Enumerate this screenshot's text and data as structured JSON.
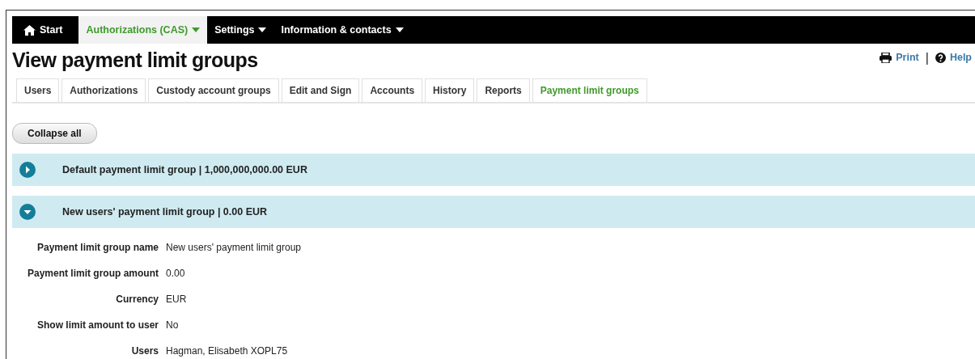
{
  "nav": [
    {
      "label": "Start",
      "kind": "home",
      "selected": false
    },
    {
      "label": "Authorizations (CAS)",
      "kind": "menu",
      "selected": true
    },
    {
      "label": "Settings",
      "kind": "menu",
      "selected": false
    },
    {
      "label": "Information & contacts",
      "kind": "menu",
      "selected": false
    }
  ],
  "title": "View payment limit groups",
  "links": [
    {
      "label": "Print",
      "kind": "print"
    },
    {
      "label": "Help",
      "kind": "help"
    }
  ],
  "separator": "|",
  "tabs": [
    {
      "label": "Users",
      "selected": false
    },
    {
      "label": "Authorizations",
      "selected": false
    },
    {
      "label": "Custody account groups",
      "selected": false
    },
    {
      "label": "Edit and Sign",
      "selected": false
    },
    {
      "label": "Accounts",
      "selected": false
    },
    {
      "label": "History",
      "selected": false
    },
    {
      "label": "Reports",
      "selected": false
    },
    {
      "label": "Payment limit groups",
      "selected": true
    }
  ],
  "collapse_button": "Collapse all",
  "groups": [
    {
      "title": "Default payment limit group | 1,000,000,000.00 EUR",
      "expanded": false
    },
    {
      "title": "New users' payment limit group | 0.00 EUR",
      "expanded": true,
      "fields": [
        {
          "label": "Payment limit group name",
          "value": "New users' payment limit group"
        },
        {
          "label": "Payment limit group amount",
          "value": "0.00"
        },
        {
          "label": "Currency",
          "value": "EUR"
        },
        {
          "label": "Show limit amount to user",
          "value": "No"
        },
        {
          "label": "Users",
          "value": "Hagman, Elisabeth XOPL75"
        }
      ]
    }
  ]
}
